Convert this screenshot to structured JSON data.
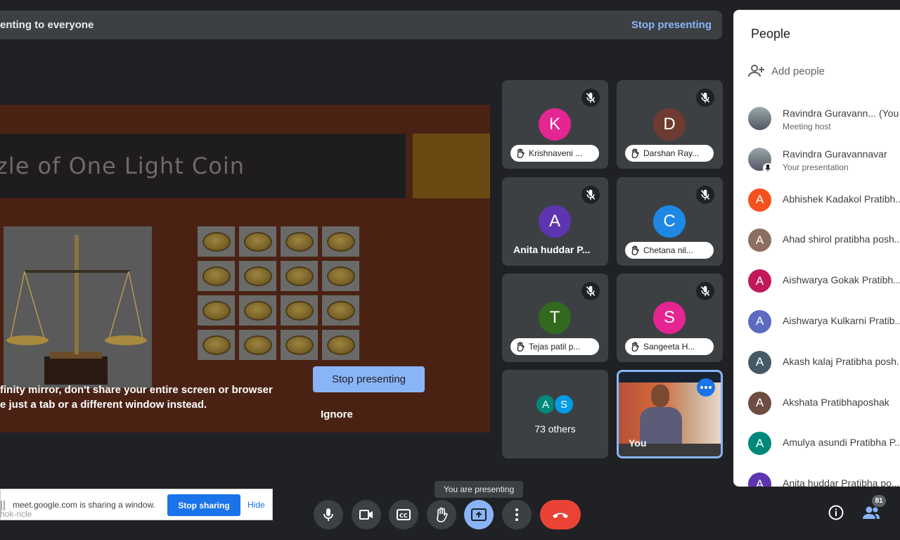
{
  "topbar": {
    "presenting_text": "enting to everyone",
    "stop_presenting_link": "Stop presenting"
  },
  "shared_screen": {
    "slide_title": "zle of One Light Coin",
    "warning_line1": "finity mirror, don't share your entire screen or browser",
    "warning_line2": "e just a tab or a different window instead.",
    "stop_button": "Stop presenting",
    "ignore_button": "Ignore"
  },
  "tiles": [
    {
      "initial": "K",
      "color": "#e52592",
      "name": "Krishnaveni ...",
      "hand": true
    },
    {
      "initial": "D",
      "color": "#6d3b2f",
      "name": "Darshan Ray...",
      "hand": true
    },
    {
      "initial": "A",
      "color": "#5e35b1",
      "name": "Anita huddar P...",
      "hand": false
    },
    {
      "initial": "C",
      "color": "#1e88e5",
      "name": "Chetana nil...",
      "hand": true
    },
    {
      "initial": "T",
      "color": "#33691e",
      "name": "Tejas patil p...",
      "hand": true
    },
    {
      "initial": "S",
      "color": "#e52592",
      "name": "Sangeeta H...",
      "hand": true
    }
  ],
  "others_tile": {
    "avatars": [
      {
        "initial": "A",
        "color": "#00897b"
      },
      {
        "initial": "S",
        "color": "#039be5"
      }
    ],
    "label": "73 others"
  },
  "you_tile": {
    "label": "You"
  },
  "people_panel": {
    "title": "People",
    "add_people": "Add people",
    "participants": [
      {
        "initial": "",
        "color": "",
        "name": "Ravindra Guravann...    (You",
        "sub": "Meeting host",
        "photo": true
      },
      {
        "initial": "",
        "color": "",
        "name": "Ravindra Guravannavar",
        "sub": "Your presentation",
        "photo": true
      },
      {
        "initial": "A",
        "color": "#f4511e",
        "name": "Abhishek Kadakol Pratibh...",
        "sub": ""
      },
      {
        "initial": "A",
        "color": "#8d6e63",
        "name": "Ahad shirol pratibha posh...",
        "sub": ""
      },
      {
        "initial": "A",
        "color": "#c2185b",
        "name": "Aishwarya Gokak Pratibh...",
        "sub": ""
      },
      {
        "initial": "A",
        "color": "#5c6bc0",
        "name": "Aishwarya Kulkarni Pratib...",
        "sub": ""
      },
      {
        "initial": "A",
        "color": "#455a64",
        "name": "Akash kalaj Pratibha posh...",
        "sub": ""
      },
      {
        "initial": "A",
        "color": "#6d4c41",
        "name": "Akshata Pratibhaposhak",
        "sub": ""
      },
      {
        "initial": "A",
        "color": "#00897b",
        "name": "Amulya asundi Pratibha P...",
        "sub": ""
      },
      {
        "initial": "A",
        "color": "#5e35b1",
        "name": "Anita huddar Pratibha po...",
        "sub": ""
      }
    ]
  },
  "share_bar": {
    "message": "meet.google.com is sharing a window.",
    "stop_sharing": "Stop sharing",
    "hide": "Hide"
  },
  "bottom_url": "hok-ncle",
  "tooltip": "You are presenting",
  "controls": [
    "microphone-icon",
    "camera-icon",
    "captions-icon",
    "raise-hand-icon",
    "present-icon",
    "more-options-icon",
    "end-call-icon"
  ],
  "people_count": "81",
  "colors": {
    "accent": "#8ab4f8",
    "background": "#202124",
    "tile": "#3c4043",
    "end_call": "#ea4335"
  }
}
